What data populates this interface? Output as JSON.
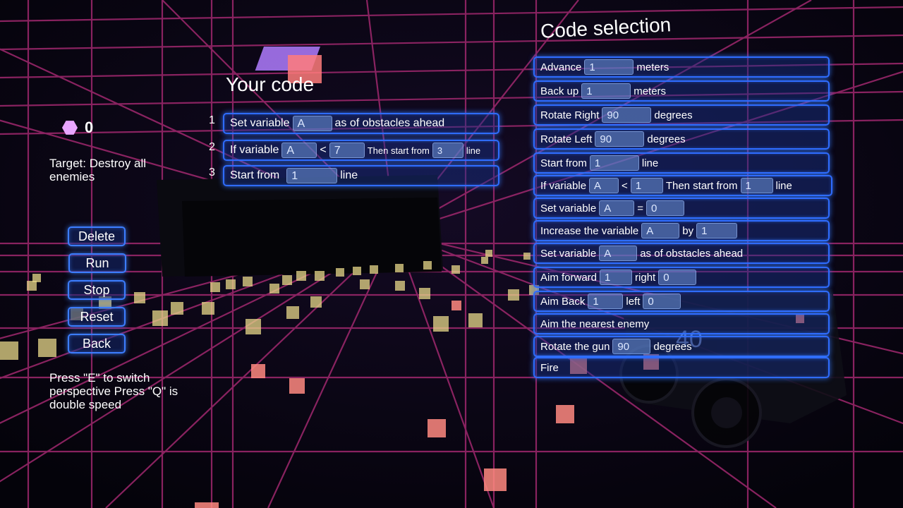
{
  "hud": {
    "gem_count": "0",
    "target": "Target: Destroy all enemies",
    "hint": "Press \"E\" to switch perspective Press \"Q\" is double speed",
    "buttons": [
      "Delete",
      "Run",
      "Stop",
      "Reset",
      "Back"
    ]
  },
  "your_code": {
    "title": "Your code",
    "lines": [
      {
        "number": "1",
        "parts": [
          "Set variable",
          "A",
          "as of obstacles ahead"
        ]
      },
      {
        "number": "2",
        "parts": [
          "If variable",
          "A",
          "<",
          "7",
          "Then start from",
          "3",
          "line"
        ]
      },
      {
        "number": "3",
        "parts": [
          "Start from",
          "1",
          "line"
        ]
      }
    ]
  },
  "code_selection": {
    "title": "Code selection",
    "items": [
      {
        "label": "Advance",
        "v1": "1",
        "unit": "meters"
      },
      {
        "label": "Back up",
        "v1": "1",
        "unit": "meters"
      },
      {
        "label": "Rotate Right",
        "v1": "90",
        "unit": "degrees"
      },
      {
        "label": "Rotate Left",
        "v1": "90",
        "unit": "degrees"
      },
      {
        "label": "Start from",
        "v1": "1",
        "unit": "line"
      },
      {
        "label": "If variable",
        "v1": "A",
        "op": "<",
        "v2": "1",
        "mid": "Then start from",
        "v3": "1",
        "unit": "line"
      },
      {
        "label": "Set variable",
        "v1": "A",
        "op": "=",
        "v2": "0"
      },
      {
        "label": "Increase the variable",
        "v1": "A",
        "op": "by",
        "v2": "1"
      },
      {
        "label": "Set variable",
        "v1": "A",
        "unit": "as of obstacles ahead"
      },
      {
        "label": "Aim forward",
        "v1": "1",
        "op": "right",
        "v2": "0"
      },
      {
        "label": "Aim Back",
        "v1": "1",
        "op": "left",
        "v2": "0"
      },
      {
        "label": "Aim the nearest enemy"
      },
      {
        "label": "Rotate the gun",
        "v1": "90",
        "unit": "degrees"
      },
      {
        "label": "Fire"
      }
    ]
  },
  "world": {
    "enemy_label": "40",
    "colors": {
      "grid": "#a0286e",
      "panel": "#2f6cff",
      "orb_yellow": "#e8d88a",
      "orb_pink": "#ff8a80"
    }
  }
}
